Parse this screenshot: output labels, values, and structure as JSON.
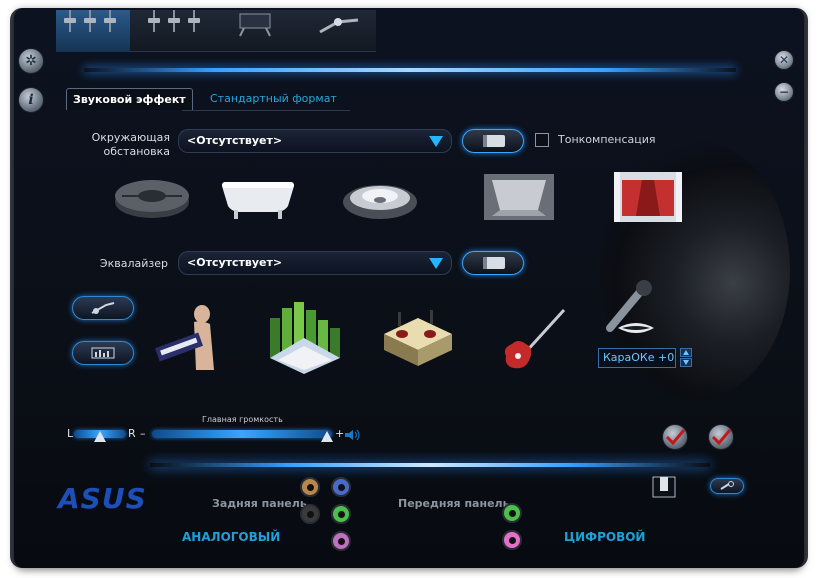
{
  "tabs": {
    "active": "Звуковой эффект",
    "inactive": "Стандартный формат"
  },
  "environment": {
    "label": "Окружающая обстановка",
    "dropdown_value": "<Отсутствует>",
    "loudness_label": "Тонкомпенсация",
    "presets": [
      "stone-room-icon",
      "bathtub-icon",
      "arena-icon",
      "hallway-icon",
      "theater-icon"
    ]
  },
  "equalizer": {
    "label": "Эквалайзер",
    "dropdown_value": "<Отсутствует>",
    "presets": [
      "keyboard-player-icon",
      "city-sound-icon",
      "party-icon",
      "electric-guitar-icon",
      "microphone-icon"
    ]
  },
  "karaoke": {
    "value": "КараОКе  +0"
  },
  "volume": {
    "title": "Главная громкость",
    "left": "L",
    "right": "R",
    "minus": "–",
    "plus": "+",
    "balance": 0.5,
    "level": 0.97
  },
  "footer": {
    "brand": "ASUS",
    "rear_panel": "Задняя панель",
    "front_panel": "Передняя панель",
    "analog": "АНАЛОГОВЫЙ",
    "digital": "ЦИФРОВОЙ"
  },
  "colors": {
    "accent": "#23b5ff",
    "brand": "#1c4fb8",
    "jack_orange": "#b8884a",
    "jack_blue": "#4a6acb",
    "jack_black": "#3a3a3a",
    "jack_green": "#4bbf4b",
    "jack_pink": "#c070c0"
  }
}
